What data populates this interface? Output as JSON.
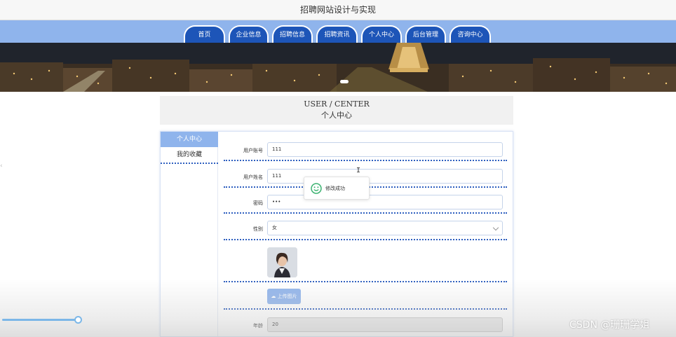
{
  "site": {
    "title": "招聘网站设计与实现"
  },
  "nav": {
    "tabs": [
      "首页",
      "企业信息",
      "招聘信息",
      "招聘资讯",
      "个人中心",
      "后台管理",
      "咨询中心"
    ]
  },
  "section": {
    "title_en": "USER / CENTER",
    "title_cn": "个人中心"
  },
  "sidebar": {
    "items": [
      "个人中心",
      "我的收藏"
    ]
  },
  "form": {
    "username": {
      "label": "用户账号",
      "value": "111"
    },
    "name": {
      "label": "用户姓名",
      "value": "111"
    },
    "password": {
      "label": "密码",
      "value": "•••"
    },
    "gender": {
      "label": "性别",
      "value": "女"
    },
    "upload_label": "上传图片",
    "age": {
      "label": "年龄",
      "value": "20"
    }
  },
  "toast": {
    "message": "修改成功"
  },
  "watermark": "CSDN @珊珊学姐",
  "colors": {
    "nav_strip": "#8fb4ec",
    "nav_tab": "#1d55b8",
    "accent_dotted": "#2e5fbf",
    "success": "#3cb371"
  }
}
